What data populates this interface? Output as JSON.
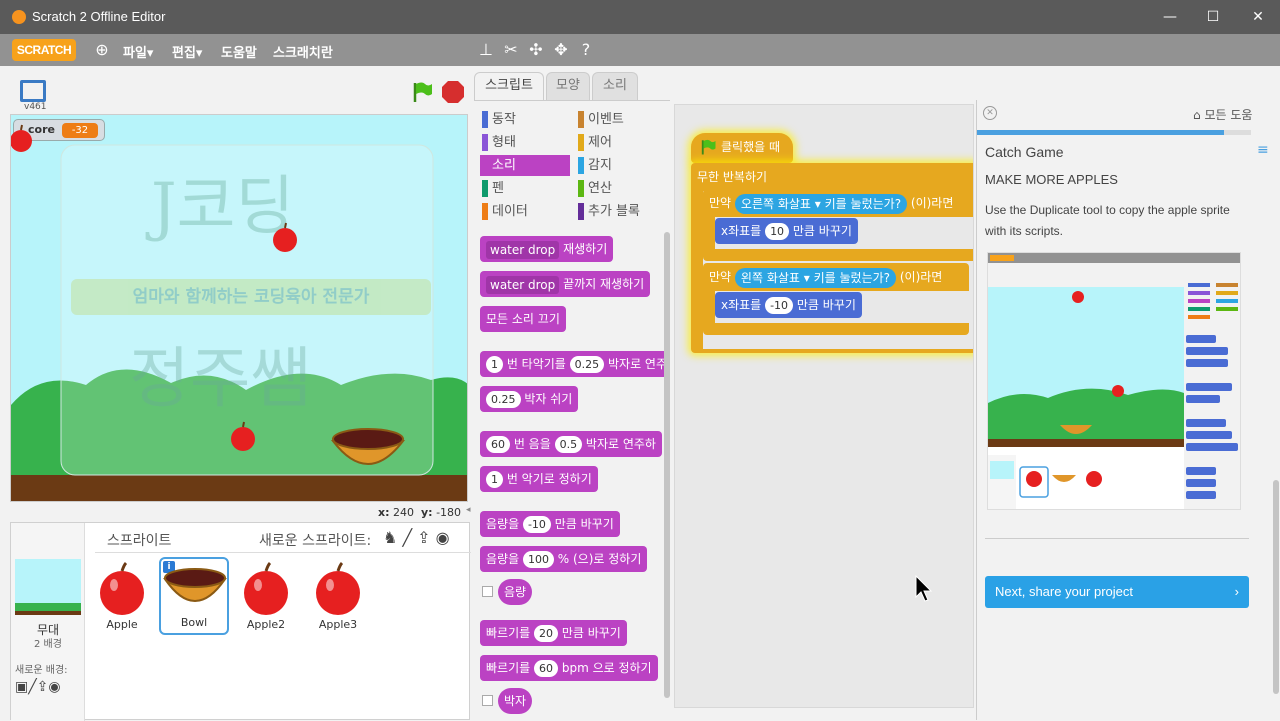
{
  "window": {
    "title": "Scratch 2 Offline Editor"
  },
  "menu": {
    "brand": "SCRATCH",
    "items": [
      "파일▾",
      "편집▾",
      "도움말",
      "스크래치란"
    ]
  },
  "stage": {
    "version": "v461",
    "score_label": "core",
    "score_value": "-32",
    "coords_x_label": "x:",
    "coords_x": "240",
    "coords_y_label": "y:",
    "coords_y": "-180",
    "watermark_top": "J코딩",
    "watermark_banner": "엄마와 함께하는 코딩육아 전문가",
    "watermark_bottom": "정주쌤"
  },
  "sprites_panel": {
    "title": "스프라이트",
    "new_sprite_label": "새로운 스프라이트:",
    "stage_label": "무대",
    "stage_backdrops": "2 배경",
    "new_backdrop_label": "새로운 배경:",
    "sprites": [
      {
        "name": "Apple",
        "selected": false
      },
      {
        "name": "Bowl",
        "selected": true
      },
      {
        "name": "Apple2",
        "selected": false
      },
      {
        "name": "Apple3",
        "selected": false
      }
    ]
  },
  "tabs": [
    "스크립트",
    "모양",
    "소리"
  ],
  "categories": [
    {
      "label": "동작",
      "color": "#4a6cd4"
    },
    {
      "label": "이벤트",
      "color": "#c88330"
    },
    {
      "label": "형태",
      "color": "#8a55d7"
    },
    {
      "label": "제어",
      "color": "#e1a91a"
    },
    {
      "label": "소리",
      "color": "#bb42c3"
    },
    {
      "label": "감지",
      "color": "#2ca5e2"
    },
    {
      "label": "펜",
      "color": "#0e9a6c"
    },
    {
      "label": "연산",
      "color": "#5cb712"
    },
    {
      "label": "데이터",
      "color": "#ee7d16"
    },
    {
      "label": "추가 블록",
      "color": "#632d99"
    }
  ],
  "palette": {
    "b1_drop": "water drop",
    "b1_text": "재생하기",
    "b2_drop": "water drop",
    "b2_text": "끝까지 재생하기",
    "b3_text": "모든 소리 끄기",
    "b4_num": "1",
    "b4_text1": "번 타악기를",
    "b4_beats": "0.25",
    "b4_text2": "박자로 연주",
    "b5_num": "0.25",
    "b5_text": "박자 쉬기",
    "b6_num": "60",
    "b6_text1": "번 음을",
    "b6_beats": "0.5",
    "b6_text2": "박자로 연주하",
    "b7_num": "1",
    "b7_text": "번 악기로 정하기",
    "b8_text1": "음량을",
    "b8_num": "-10",
    "b8_text2": "만큼 바꾸기",
    "b9_text1": "음량을",
    "b9_num": "100",
    "b9_text2": "% (으)로 정하기",
    "b10_text": "음량",
    "b11_text1": "빠르기를",
    "b11_num": "20",
    "b11_text2": "만큼 바꾸기",
    "b12_text1": "빠르기를",
    "b12_num": "60",
    "b12_text2": "bpm 으로 정하기",
    "b13_text": "박자"
  },
  "script": {
    "hat": "클릭했을 때",
    "forever": "무한 반복하기",
    "if1_label": "만약",
    "if1_key": "오른쪽 화살표",
    "if1_sense": "키를 눌렀는가?",
    "if1_then": "(이)라면",
    "move1_label": "x좌표를",
    "move1_value": "10",
    "move1_suffix": "만큼 바꾸기",
    "if2_label": "만약",
    "if2_key": "왼쪽 화살표",
    "if2_sense": "키를 눌렀는가?",
    "if2_then": "(이)라면",
    "move2_label": "x좌표를",
    "move2_value": "-10",
    "move2_suffix": "만큼 바꾸기"
  },
  "help": {
    "all_help": "모든 도움",
    "title": "Catch Game",
    "subtitle": "MAKE MORE APPLES",
    "body": "Use the Duplicate tool to copy the apple sprite with its scripts.",
    "next_label": "Next, share your project",
    "progress": 0.9
  }
}
